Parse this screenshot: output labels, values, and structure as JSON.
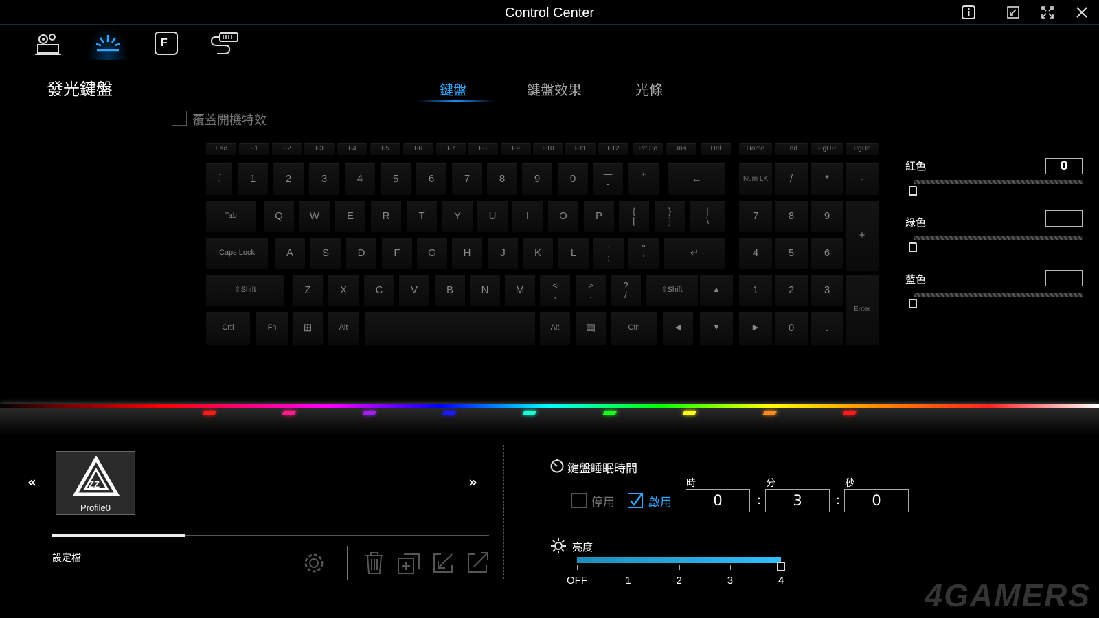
{
  "app": {
    "title": "Control Center"
  },
  "window_controls": [
    "info-icon",
    "restore-icon",
    "fullscreen-icon",
    "close-icon"
  ],
  "top_nav": [
    {
      "icon": "system-settings-icon",
      "active": false
    },
    {
      "icon": "lighting-icon",
      "active": true
    },
    {
      "icon": "fn-key-icon",
      "active": false
    },
    {
      "icon": "usb-device-icon",
      "active": false
    }
  ],
  "section": {
    "title": "發光鍵盤"
  },
  "tabs": [
    {
      "label": "鍵盤",
      "active": true
    },
    {
      "label": "鍵盤效果",
      "active": false
    },
    {
      "label": "光條",
      "active": false
    }
  ],
  "override_boot_effect": {
    "label": "覆蓋開機特效",
    "checked": false
  },
  "keys": [
    "Esc",
    "F1",
    "F2",
    "F3",
    "F4",
    "F5",
    "F6",
    "F7",
    "F8",
    "F9",
    "F10",
    "F11",
    "F12",
    "Prt Sc",
    "Ins",
    "Del",
    "Home",
    "End",
    "PgUP",
    "PgDn",
    "~\n`",
    "1",
    "2",
    "3",
    "4",
    "5",
    "6",
    "7",
    "8",
    "9",
    "0",
    "—\n-",
    "+\n=",
    "←",
    "Num LK",
    "/",
    "*",
    "-",
    "Tab",
    "Q",
    "W",
    "E",
    "R",
    "T",
    "Y",
    "U",
    "I",
    "O",
    "P",
    "{\n[",
    "}\n]",
    "|\n\\",
    "7",
    "8",
    "9",
    "+",
    "Caps Lock",
    "A",
    "S",
    "D",
    "F",
    "G",
    "H",
    "J",
    "K",
    "L",
    ":\n;",
    "\"\n'",
    "↵",
    "4",
    "5",
    "6",
    "⇧Shift",
    "Z",
    "X",
    "C",
    "V",
    "B",
    "N",
    "M",
    "<\n,",
    ">\n.",
    "?\n/",
    "⇧Shift",
    "▲",
    "1",
    "2",
    "3",
    "Enter",
    "Crtl",
    "Fn",
    "⊞",
    "Alt",
    "",
    "Alt",
    "▤",
    "Ctrl",
    "◀",
    "▼",
    "▶",
    "0",
    "."
  ],
  "color": {
    "red": {
      "label": "紅色",
      "value": "0",
      "level": 0
    },
    "green": {
      "label": "綠色",
      "value": "",
      "level": 0
    },
    "blue": {
      "label": "藍色",
      "value": "",
      "level": 0
    }
  },
  "profiles": {
    "items": [
      {
        "name": "Profile0",
        "selected": true
      }
    ],
    "label": "設定檔",
    "prev": "«",
    "next": "»"
  },
  "sleep": {
    "title": "鍵盤睡眠時間",
    "disable_label": "停用",
    "enable_label": "啟用",
    "enabled": true,
    "hour_label": "時",
    "minute_label": "分",
    "second_label": "秒",
    "hours": "0",
    "minutes": "3",
    "seconds": "0"
  },
  "brightness": {
    "label": "亮度",
    "ticks": [
      "OFF",
      "1",
      "2",
      "3",
      "4"
    ],
    "value": 4,
    "max": 4
  },
  "profile_tools": [
    "settings-icon",
    "delete-icon",
    "add-icon",
    "import-icon",
    "export-icon"
  ],
  "led_colors": [
    "#ff1a1a",
    "#ff1a8c",
    "#a020f0",
    "#1a1aff",
    "#1affd5",
    "#1aff1a",
    "#ffff1a",
    "#ff8c1a",
    "#ff1a1a"
  ],
  "watermark": "4GAMERS"
}
